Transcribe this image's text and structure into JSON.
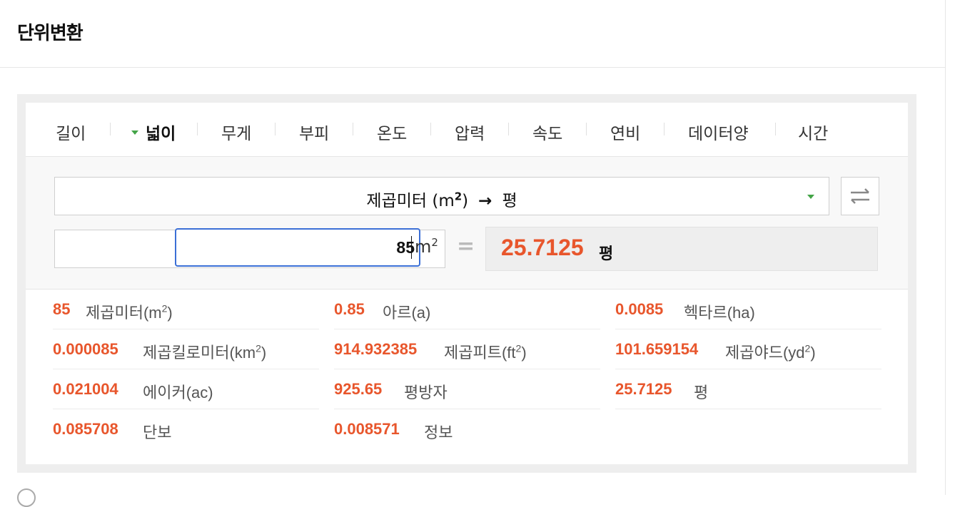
{
  "header": {
    "title": "단위변환"
  },
  "tabs": [
    {
      "label": "길이",
      "active": false
    },
    {
      "label": "넓이",
      "active": true
    },
    {
      "label": "무게",
      "active": false
    },
    {
      "label": "부피",
      "active": false
    },
    {
      "label": "온도",
      "active": false
    },
    {
      "label": "압력",
      "active": false
    },
    {
      "label": "속도",
      "active": false
    },
    {
      "label": "연비",
      "active": false
    },
    {
      "label": "데이터양",
      "active": false
    },
    {
      "label": "시간",
      "active": false
    }
  ],
  "converter": {
    "from_unit": "제곱미터 (m",
    "from_unit_sup": "2",
    "from_unit_close": ")",
    "arrow": "→",
    "to_unit": "평",
    "input_value": "85",
    "input_unit": "m",
    "input_unit_sup": "2",
    "equals": "=",
    "result_value": "25.7125",
    "result_unit": "평",
    "accent_color": "#e8562c",
    "dropdown_color": "#43a447"
  },
  "results": [
    {
      "value": "85",
      "name": "제곱미터(m",
      "sup": "2",
      "close": ")"
    },
    {
      "value": "0.85",
      "name": "아르(a)",
      "sup": "",
      "close": ""
    },
    {
      "value": "0.0085",
      "name": "헥타르(ha)",
      "sup": "",
      "close": ""
    },
    {
      "value": "0.000085",
      "name": "제곱킬로미터(km",
      "sup": "2",
      "close": ")"
    },
    {
      "value": "914.932385",
      "name": "제곱피트(ft",
      "sup": "2",
      "close": ")"
    },
    {
      "value": "101.659154",
      "name": "제곱야드(yd",
      "sup": "2",
      "close": ")"
    },
    {
      "value": "0.021004",
      "name": "에이커(ac)",
      "sup": "",
      "close": ""
    },
    {
      "value": "925.65",
      "name": "평방자",
      "sup": "",
      "close": ""
    },
    {
      "value": "25.7125",
      "name": "평",
      "sup": "",
      "close": ""
    },
    {
      "value": "0.085708",
      "name": "단보",
      "sup": "",
      "close": ""
    },
    {
      "value": "0.008571",
      "name": "정보",
      "sup": "",
      "close": ""
    }
  ]
}
